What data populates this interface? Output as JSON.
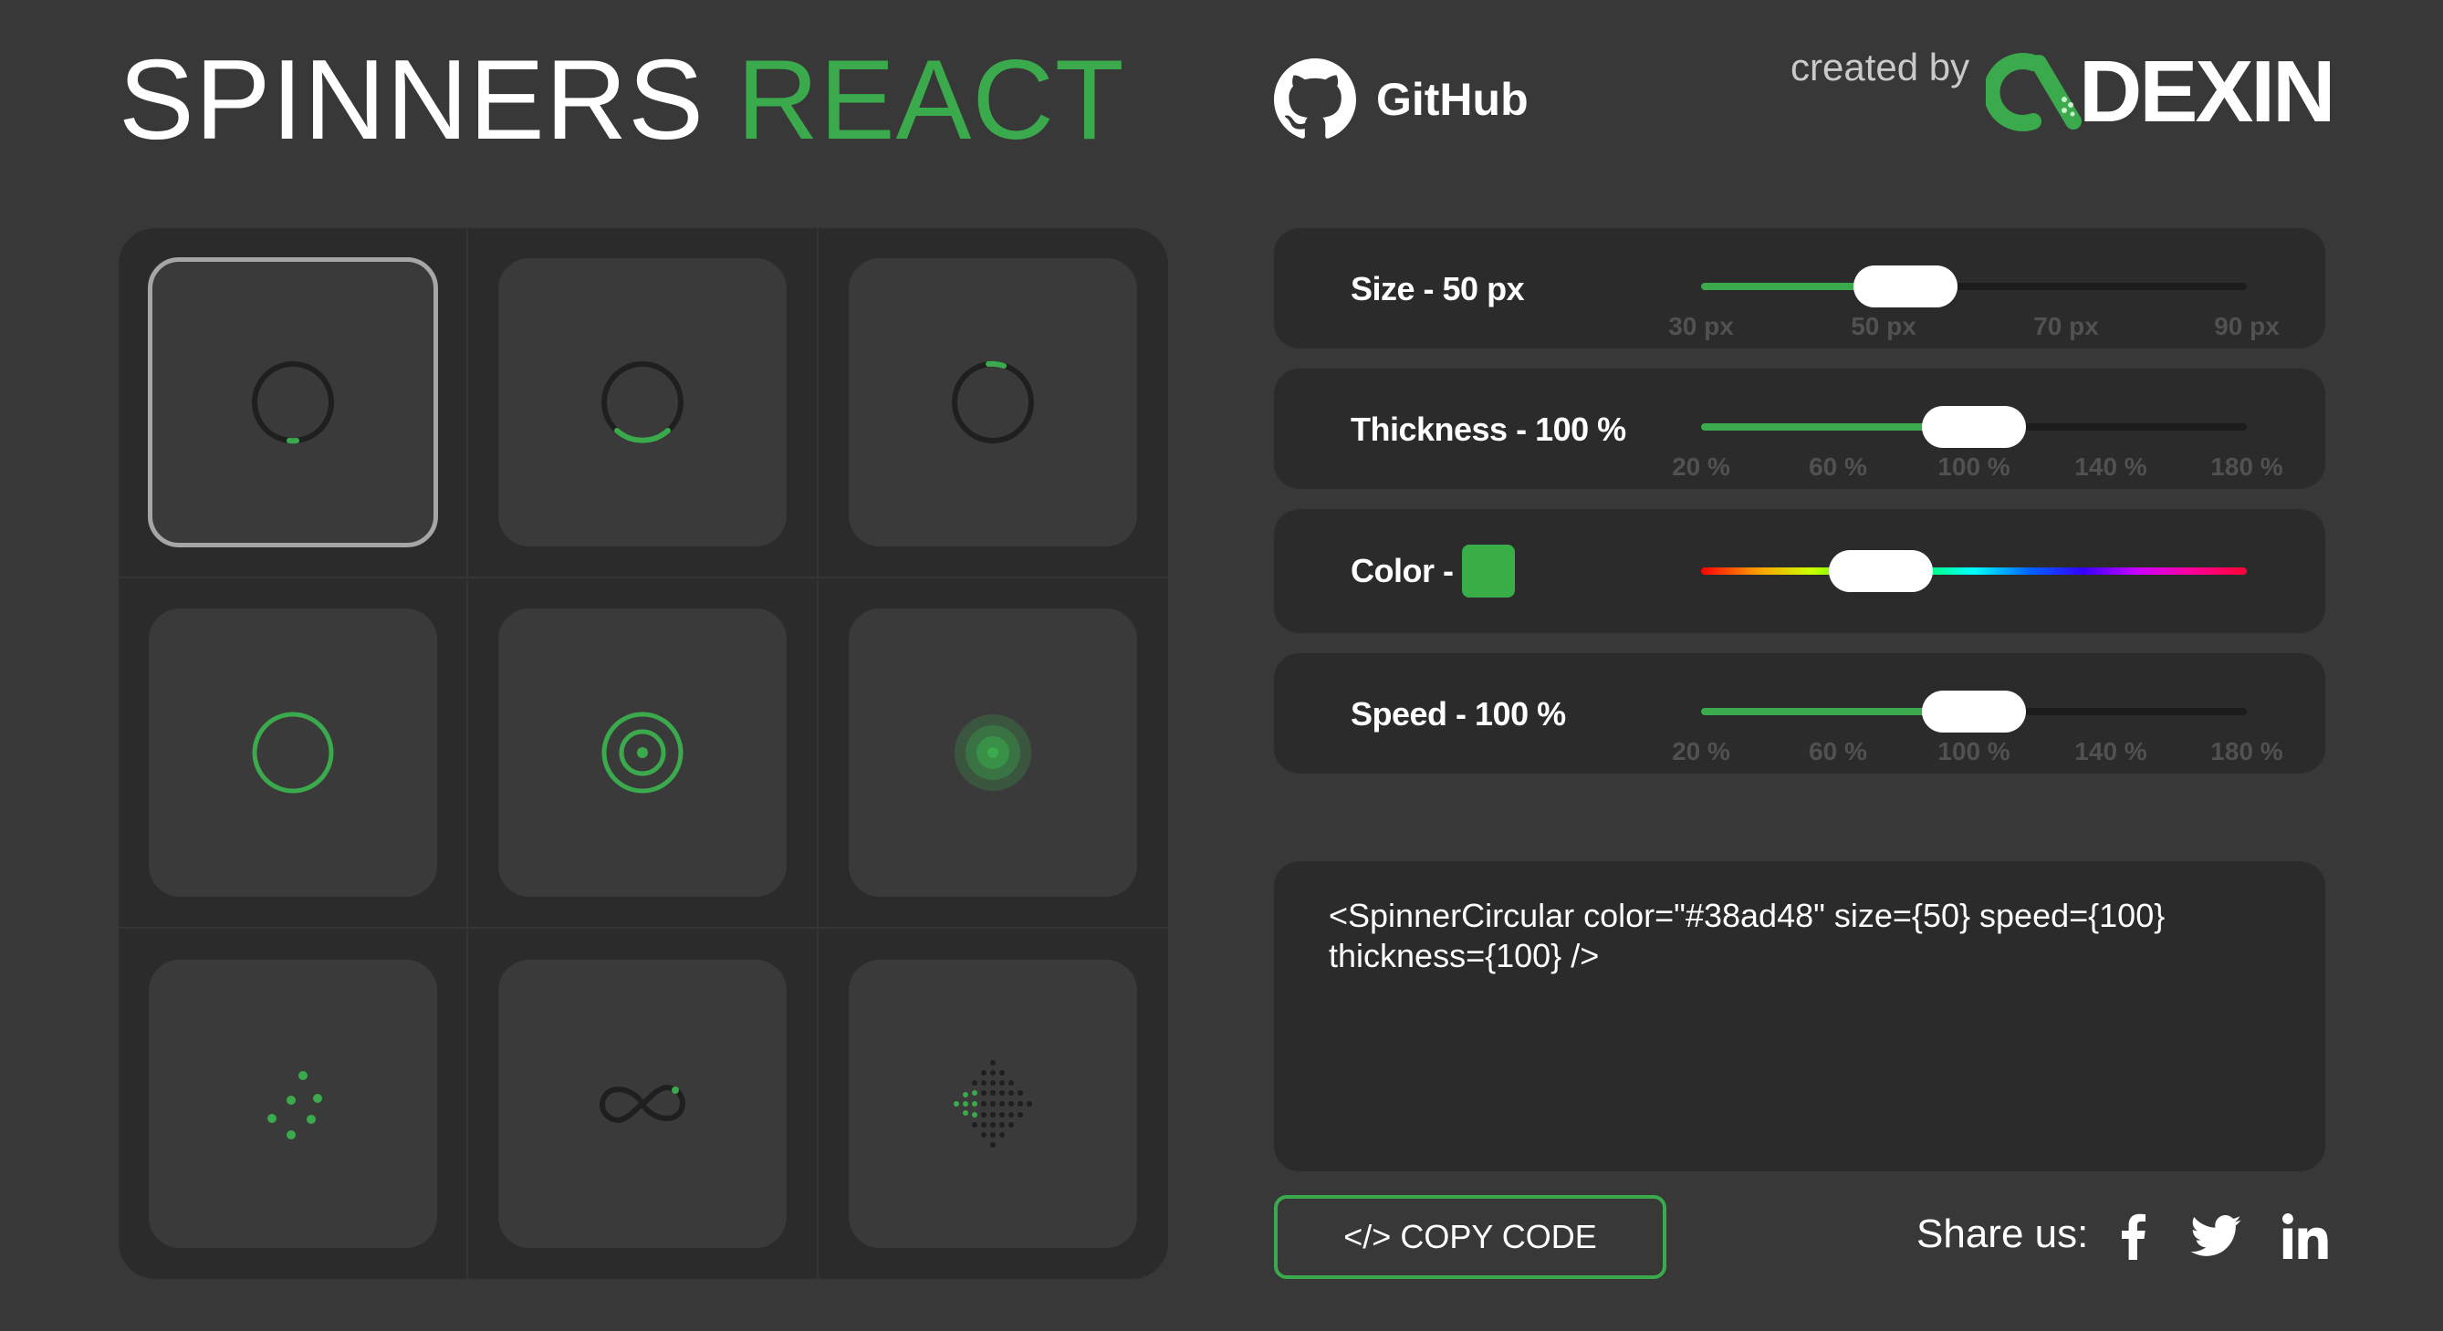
{
  "header": {
    "title_part1": "SPINNERS",
    "title_part2": "REACT",
    "github_label": "GitHub",
    "created_by": "created by",
    "logo_word": "DEXIN"
  },
  "spinners": [
    {
      "name": "SpinnerCircular",
      "icon": "circular-spinner-icon",
      "selected": true
    },
    {
      "name": "SpinnerCircularFixed",
      "icon": "circular-fixed-spinner-icon",
      "selected": false
    },
    {
      "name": "SpinnerCircularSplit",
      "icon": "circular-split-spinner-icon",
      "selected": false
    },
    {
      "name": "SpinnerRound",
      "icon": "round-spinner-icon",
      "selected": false
    },
    {
      "name": "SpinnerRoundOutlined",
      "icon": "round-outlined-spinner-icon",
      "selected": false
    },
    {
      "name": "SpinnerRoundFilled",
      "icon": "round-filled-spinner-icon",
      "selected": false
    },
    {
      "name": "SpinnerDotted",
      "icon": "dotted-spinner-icon",
      "selected": false
    },
    {
      "name": "SpinnerInfinity",
      "icon": "infinity-spinner-icon",
      "selected": false
    },
    {
      "name": "SpinnerDiamond",
      "icon": "diamond-spinner-icon",
      "selected": false
    }
  ],
  "controls": {
    "size": {
      "label": "Size - 50 px",
      "min": 20,
      "max": 100,
      "value": 50,
      "ticks": [
        "30 px",
        "50 px",
        "70 px",
        "90 px"
      ]
    },
    "thickness": {
      "label": "Thickness - 100 %",
      "min": 0,
      "max": 200,
      "value": 100,
      "ticks": [
        "20 %",
        "60 %",
        "100 %",
        "140 %",
        "180 %"
      ]
    },
    "color": {
      "label": "Color -",
      "value": "#38ad48",
      "hue_fraction": 0.33
    },
    "speed": {
      "label": "Speed - 100 %",
      "min": 0,
      "max": 200,
      "value": 100,
      "ticks": [
        "20 %",
        "60 %",
        "100 %",
        "140 %",
        "180 %"
      ]
    }
  },
  "code": {
    "line1": "<SpinnerCircular color=\"#38ad48\" size={50} speed={100}",
    "line2": "thickness={100} />"
  },
  "copy_button": "</> COPY CODE",
  "share": {
    "label": "Share us:",
    "icons": [
      "facebook-icon",
      "twitter-icon",
      "linkedin-icon"
    ]
  },
  "colors": {
    "accent": "#3aaa4c",
    "background": "#383838",
    "panel": "#2b2b2b",
    "card": "#3a3a3a"
  }
}
